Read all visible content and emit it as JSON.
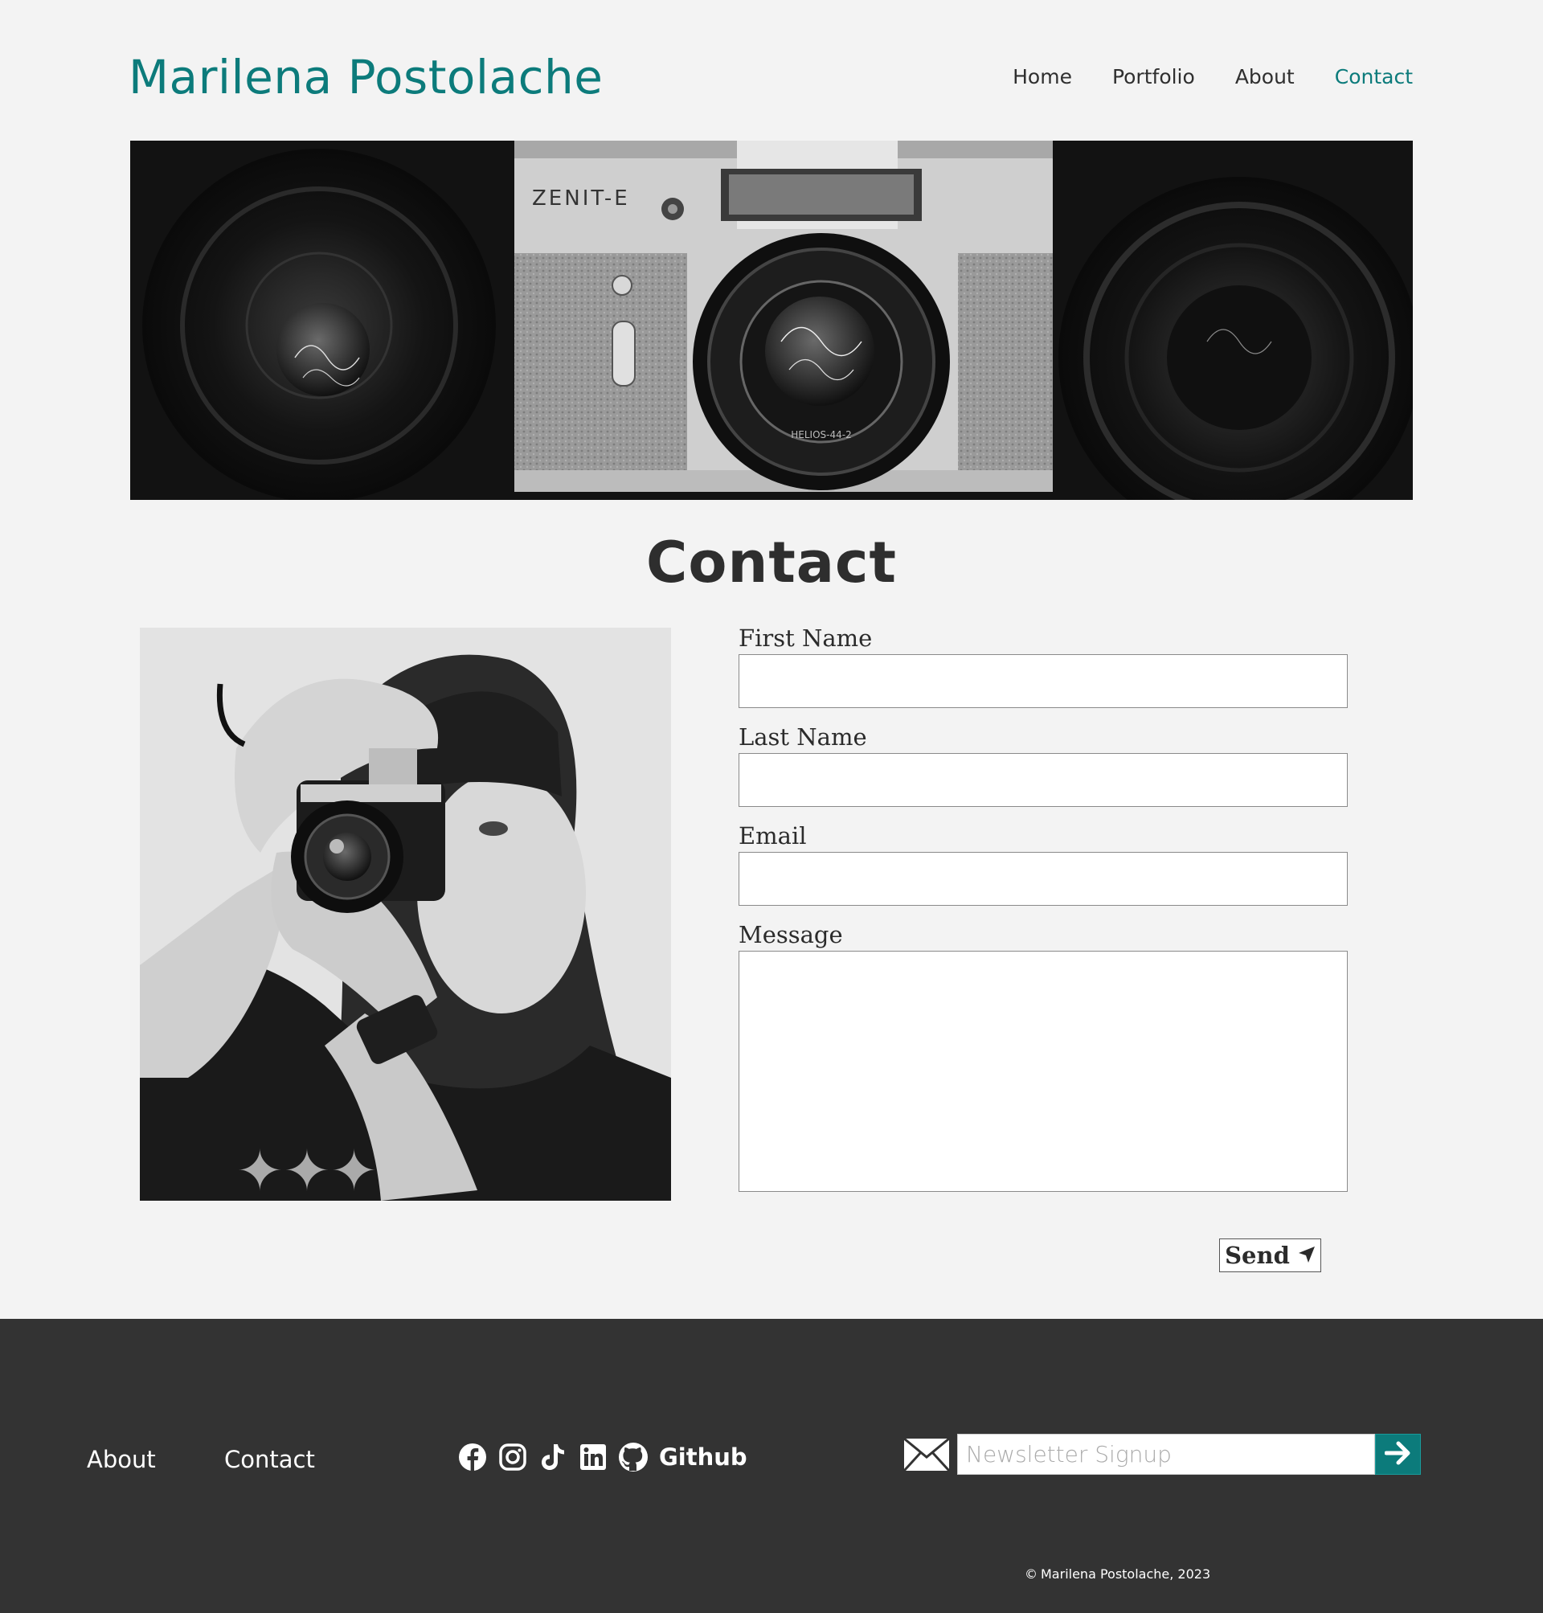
{
  "header": {
    "site_title": "Marilena Postolache",
    "nav": [
      {
        "label": "Home",
        "active": false
      },
      {
        "label": "Portfolio",
        "active": false
      },
      {
        "label": "About",
        "active": false
      },
      {
        "label": "Contact",
        "active": true
      }
    ]
  },
  "hero": {
    "camera_brand_text": "ZENIT-E",
    "lens_text": "HELIOS-44-2"
  },
  "page": {
    "heading": "Contact"
  },
  "form": {
    "first_name_label": "First Name",
    "last_name_label": "Last Name",
    "email_label": "Email",
    "message_label": "Message",
    "first_name_value": "",
    "last_name_value": "",
    "email_value": "",
    "message_value": "",
    "send_label": "Send",
    "send_icon": "paper-plane-icon"
  },
  "footer": {
    "links": [
      "About",
      "Contact"
    ],
    "social_icons": [
      "facebook-icon",
      "instagram-icon",
      "tiktok-icon",
      "linkedin-icon",
      "github-icon"
    ],
    "github_label": "Github",
    "newsletter_placeholder": "Newsletter Signup",
    "newsletter_icon": "mail-icon",
    "submit_icon": "arrow-right-icon",
    "copyright": "Marilena Postolache, 2023"
  },
  "colors": {
    "accent": "#0c7b7b",
    "background": "#f3f3f3",
    "footer_background": "#333333",
    "text": "#2e2e2e"
  }
}
